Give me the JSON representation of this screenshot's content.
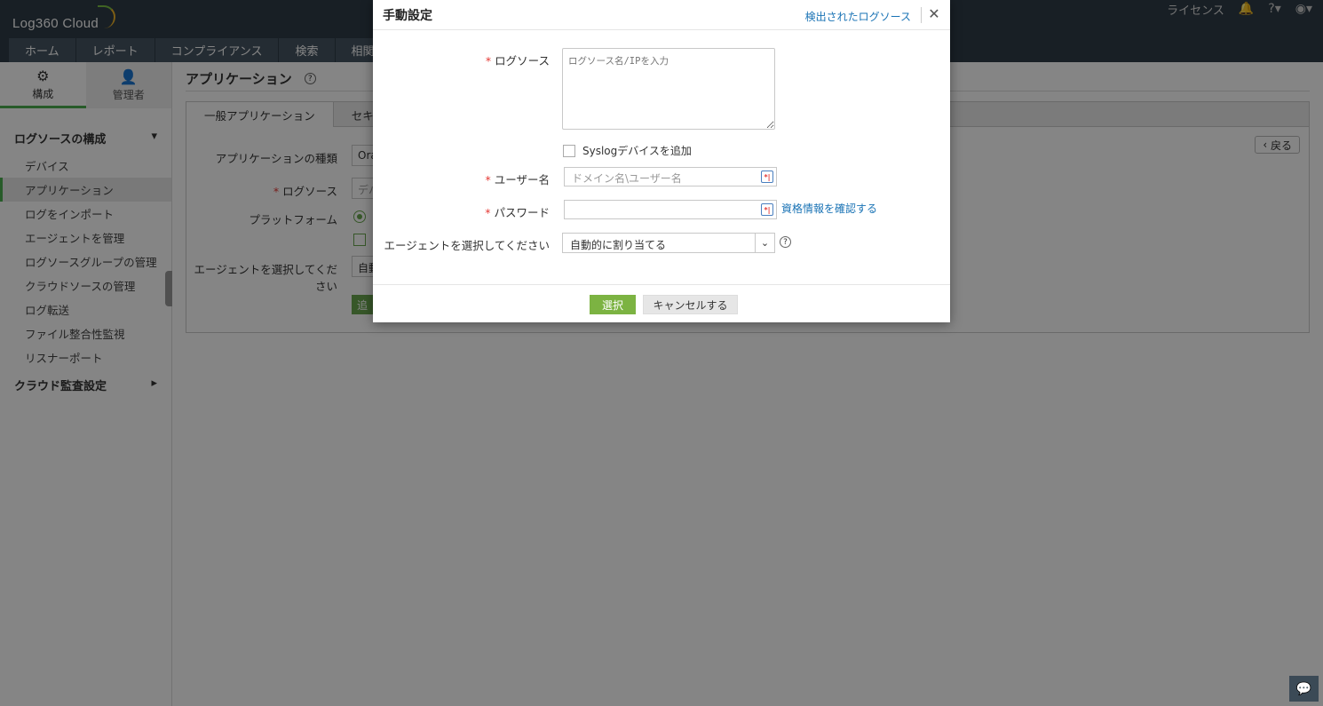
{
  "header": {
    "logo": "Log360 Cloud",
    "license": "ライセンス",
    "nav": [
      "ホーム",
      "レポート",
      "コンプライアンス",
      "検索",
      "相関"
    ]
  },
  "sidebar": {
    "tab_config": "構成",
    "tab_admin": "管理者",
    "section1": "ログソースの構成",
    "items": [
      "デバイス",
      "アプリケーション",
      "ログをインポート",
      "エージェントを管理",
      "ログソースグループの管理",
      "クラウドソースの管理",
      "ログ転送",
      "ファイル整合性監視",
      "リスナーポート"
    ],
    "section2": "クラウド監査設定"
  },
  "main": {
    "title": "アプリケーション",
    "tab1": "一般アプリケーション",
    "tab2": "セキュリ",
    "back": "戻る",
    "label_app_type": "アプリケーションの種類",
    "label_log_source": "ログソース",
    "label_platform": "プラットフォーム",
    "label_agent": "エージェントを選択してください",
    "stub_app_type": "Ora",
    "stub_log_source": "デバ",
    "stub_agent": "自動",
    "stub_button": "追"
  },
  "modal": {
    "title": "手動設定",
    "detected_link": "検出されたログソース",
    "log_source_label": "ログソース",
    "log_source_placeholder": "ログソース名/IPを入力",
    "syslog_label": "Syslogデバイスを追加",
    "username_label": "ユーザー名",
    "username_placeholder": "ドメイン名\\ユーザー名",
    "password_label": "パスワード",
    "verify_link": "資格情報を確認する",
    "agent_label": "エージェントを選択してください",
    "agent_value": "自動的に割り当てる",
    "select_button": "選択",
    "cancel_button": "キャンセルする"
  }
}
